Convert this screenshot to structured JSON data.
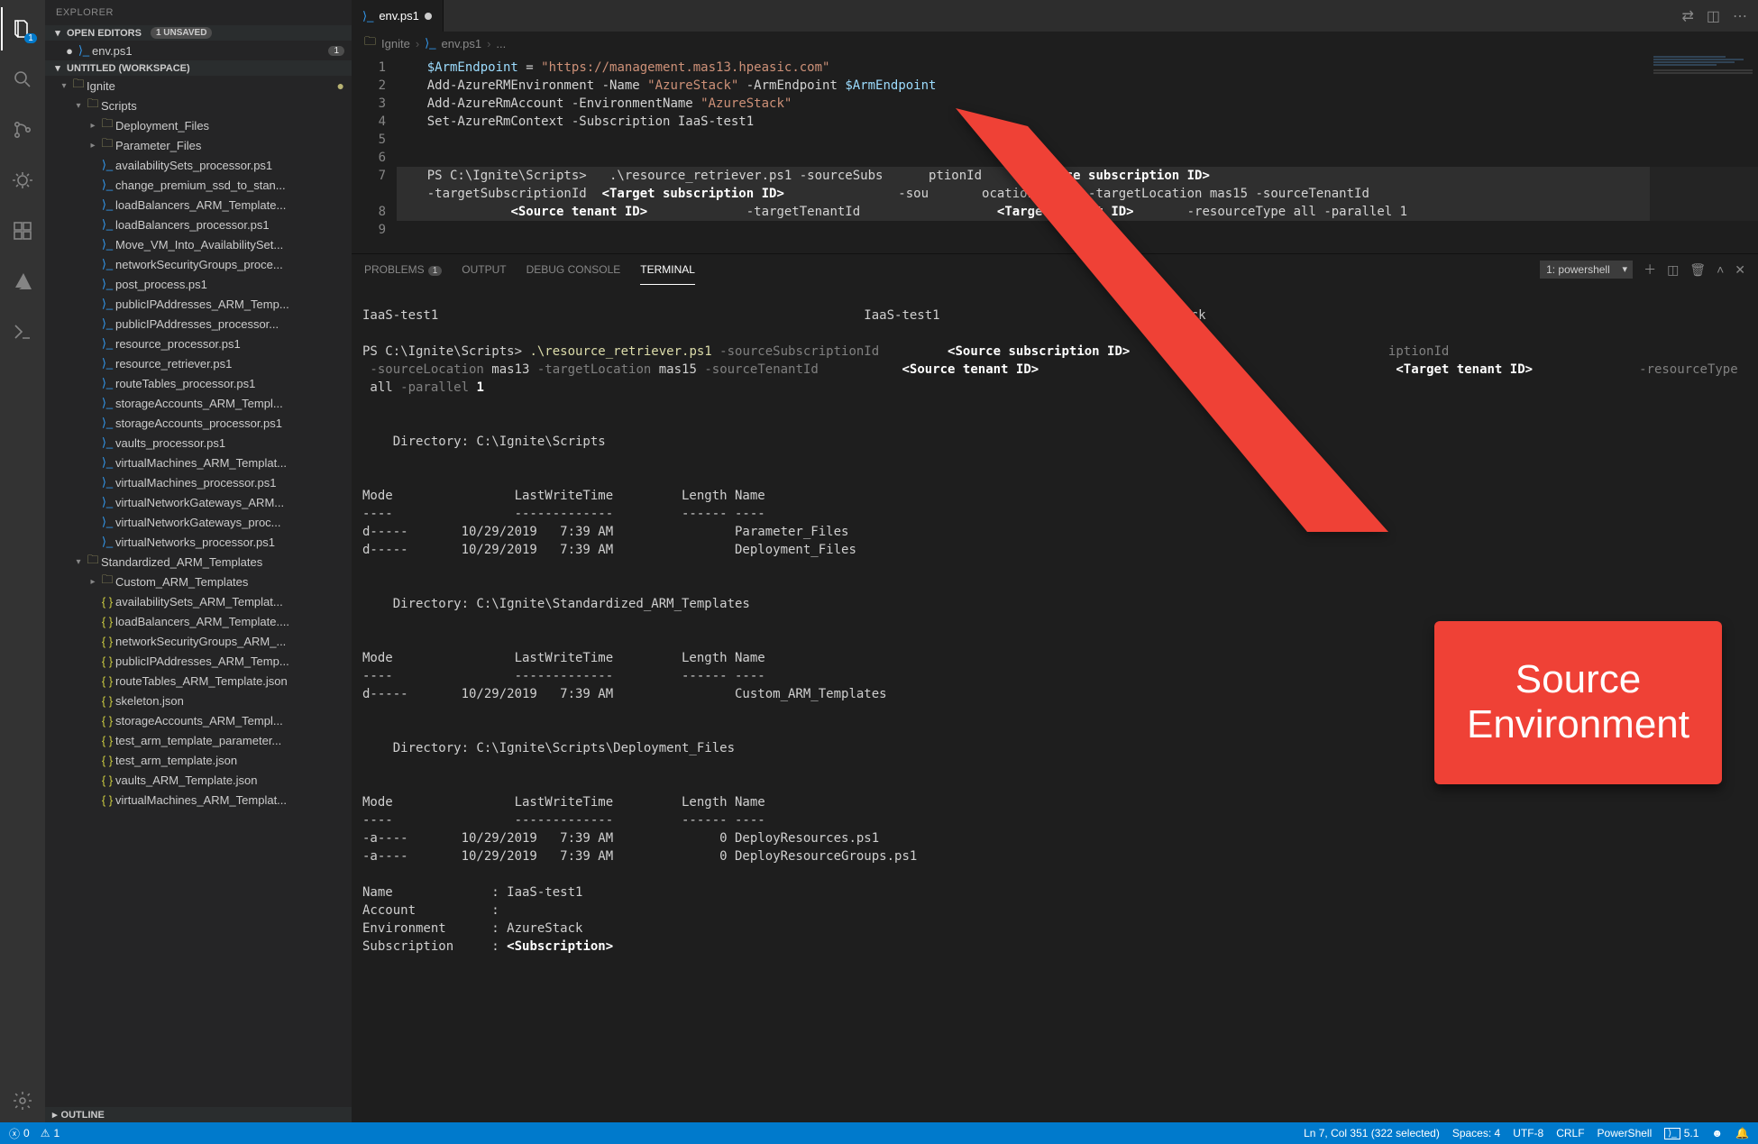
{
  "explorer": {
    "title": "EXPLORER",
    "open_editors_label": "OPEN EDITORS",
    "unsaved_pill": "1 UNSAVED",
    "open_editors": [
      {
        "label": "env.ps1",
        "badge": "1",
        "modified": true
      }
    ],
    "workspace_label": "UNTITLED (WORKSPACE)",
    "outline_label": "OUTLINE",
    "tree": [
      {
        "depth": 0,
        "twist": "v",
        "icon": "folder",
        "label": "Ignite",
        "modified": true
      },
      {
        "depth": 1,
        "twist": "v",
        "icon": "folder",
        "label": "Scripts"
      },
      {
        "depth": 2,
        "twist": ">",
        "icon": "folder",
        "label": "Deployment_Files"
      },
      {
        "depth": 2,
        "twist": ">",
        "icon": "folder",
        "label": "Parameter_Files"
      },
      {
        "depth": 2,
        "twist": "",
        "icon": "ps",
        "label": "availabilitySets_processor.ps1"
      },
      {
        "depth": 2,
        "twist": "",
        "icon": "ps",
        "label": "change_premium_ssd_to_stan..."
      },
      {
        "depth": 2,
        "twist": "",
        "icon": "ps",
        "label": "loadBalancers_ARM_Template..."
      },
      {
        "depth": 2,
        "twist": "",
        "icon": "ps",
        "label": "loadBalancers_processor.ps1"
      },
      {
        "depth": 2,
        "twist": "",
        "icon": "ps",
        "label": "Move_VM_Into_AvailabilitySet..."
      },
      {
        "depth": 2,
        "twist": "",
        "icon": "ps",
        "label": "networkSecurityGroups_proce..."
      },
      {
        "depth": 2,
        "twist": "",
        "icon": "ps",
        "label": "post_process.ps1"
      },
      {
        "depth": 2,
        "twist": "",
        "icon": "ps",
        "label": "publicIPAddresses_ARM_Temp..."
      },
      {
        "depth": 2,
        "twist": "",
        "icon": "ps",
        "label": "publicIPAddresses_processor..."
      },
      {
        "depth": 2,
        "twist": "",
        "icon": "ps",
        "label": "resource_processor.ps1"
      },
      {
        "depth": 2,
        "twist": "",
        "icon": "ps",
        "label": "resource_retriever.ps1"
      },
      {
        "depth": 2,
        "twist": "",
        "icon": "ps",
        "label": "routeTables_processor.ps1"
      },
      {
        "depth": 2,
        "twist": "",
        "icon": "ps",
        "label": "storageAccounts_ARM_Templ..."
      },
      {
        "depth": 2,
        "twist": "",
        "icon": "ps",
        "label": "storageAccounts_processor.ps1"
      },
      {
        "depth": 2,
        "twist": "",
        "icon": "ps",
        "label": "vaults_processor.ps1"
      },
      {
        "depth": 2,
        "twist": "",
        "icon": "ps",
        "label": "virtualMachines_ARM_Templat..."
      },
      {
        "depth": 2,
        "twist": "",
        "icon": "ps",
        "label": "virtualMachines_processor.ps1"
      },
      {
        "depth": 2,
        "twist": "",
        "icon": "ps",
        "label": "virtualNetworkGateways_ARM..."
      },
      {
        "depth": 2,
        "twist": "",
        "icon": "ps",
        "label": "virtualNetworkGateways_proc..."
      },
      {
        "depth": 2,
        "twist": "",
        "icon": "ps",
        "label": "virtualNetworks_processor.ps1"
      },
      {
        "depth": 1,
        "twist": "v",
        "icon": "folder",
        "label": "Standardized_ARM_Templates"
      },
      {
        "depth": 2,
        "twist": ">",
        "icon": "folder",
        "label": "Custom_ARM_Templates"
      },
      {
        "depth": 2,
        "twist": "",
        "icon": "json",
        "label": "availabilitySets_ARM_Templat..."
      },
      {
        "depth": 2,
        "twist": "",
        "icon": "json",
        "label": "loadBalancers_ARM_Template...."
      },
      {
        "depth": 2,
        "twist": "",
        "icon": "json",
        "label": "networkSecurityGroups_ARM_..."
      },
      {
        "depth": 2,
        "twist": "",
        "icon": "json",
        "label": "publicIPAddresses_ARM_Temp..."
      },
      {
        "depth": 2,
        "twist": "",
        "icon": "json",
        "label": "routeTables_ARM_Template.json"
      },
      {
        "depth": 2,
        "twist": "",
        "icon": "json",
        "label": "skeleton.json"
      },
      {
        "depth": 2,
        "twist": "",
        "icon": "json",
        "label": "storageAccounts_ARM_Templ..."
      },
      {
        "depth": 2,
        "twist": "",
        "icon": "json",
        "label": "test_arm_template_parameter..."
      },
      {
        "depth": 2,
        "twist": "",
        "icon": "json",
        "label": "test_arm_template.json"
      },
      {
        "depth": 2,
        "twist": "",
        "icon": "json",
        "label": "vaults_ARM_Template.json"
      },
      {
        "depth": 2,
        "twist": "",
        "icon": "json",
        "label": "virtualMachines_ARM_Templat..."
      }
    ]
  },
  "tabs": {
    "active": "env.ps1"
  },
  "breadcrumbs": {
    "a": "Ignite",
    "b": "env.ps1",
    "c": "..."
  },
  "editor_lines": [
    "1",
    "2",
    "3",
    "4",
    "5",
    "6",
    "7",
    "",
    "8",
    "9"
  ],
  "code": {
    "l1": {
      "a": "    ",
      "b": "$ArmEndpoint",
      "c": " = ",
      "d": "\"https://management.mas13.hpeasic.com\""
    },
    "l2": {
      "a": "    Add-AzureRMEnvironment ",
      "b": "-Name ",
      "c": "\"AzureStack\"",
      "d": " -ArmEndpoint ",
      "e": "$ArmEndpoint"
    },
    "l3": {
      "a": "    Add-AzureRmAccount ",
      "b": "-EnvironmentName ",
      "c": "\"AzureStack\""
    },
    "l4": {
      "a": "    Set-AzureRmContext ",
      "b": "-Subscription IaaS-test1"
    },
    "l7a": {
      "a": "    PS C:\\Ignite\\Scripts>   .\\resource_retriever.ps1 -sourceSubs      ptionId ",
      "b": "     <Source subscription ID>          "
    },
    "l7b": {
      "a": "    -targetSubscriptionId  ",
      "b": "<Target subscription ID>",
      "c": "               -sou       ocation mas13 -targetLocation mas15 -sourceTenantId"
    },
    "l7c": {
      "a": "               ",
      "b": "<Source tenant ID>",
      "c": "             -targetTenantId                  ",
      "d": "<Target tenant ID>",
      "e": "       -resourceType all -parallel 1"
    }
  },
  "panel": {
    "problems": "PROBLEMS",
    "problems_badge": "1",
    "output": "OUTPUT",
    "debug": "DEBUG CONSOLE",
    "terminal": "TERMINAL",
    "dropdown": "1: powershell"
  },
  "terminal": {
    "l01": "IaaS-test1                                                        IaaS-test1                              Stack",
    "l02": "",
    "l03a": "PS C:\\Ignite\\Scripts> ",
    "l03b": ".\\resource_retriever.ps1",
    "l03c": " -sourceSubscriptionId         ",
    "l03d": "<Source subscription ID>",
    "l03e": "                                  iptionId",
    "l04a": " -sourceLocation ",
    "l04b": "mas13",
    "l04c": " -targetLocation ",
    "l04d": "mas15",
    "l04e": " -sourceTenantId           ",
    "l04f": "<Source tenant ID>",
    "l04g": "                                               ",
    "l04h": "<Target tenant ID>",
    "l04i": "              -resourceType",
    "l05a": " all",
    "l05b": " -parallel ",
    "l05c": "1",
    "dir1": "    Directory: C:\\Ignite\\Scripts",
    "hdr": "Mode                LastWriteTime         Length Name",
    "hdr2": "----                -------------         ------ ----",
    "r1": "d-----       10/29/2019   7:39 AM                Parameter_Files",
    "r2": "d-----       10/29/2019   7:39 AM                Deployment_Files",
    "dir2": "    Directory: C:\\Ignite\\Standardized_ARM_Templates",
    "r3": "d-----       10/29/2019   7:39 AM                Custom_ARM_Templates",
    "dir3": "    Directory: C:\\Ignite\\Scripts\\Deployment_Files",
    "r4": "-a----       10/29/2019   7:39 AM              0 DeployResources.ps1",
    "r5": "-a----       10/29/2019   7:39 AM              0 DeployResourceGroups.ps1",
    "kv1": "Name             : IaaS-test1",
    "kv2": "Account          :",
    "kv3": "Environment      : AzureStack",
    "kv4a": "Subscription     : ",
    "kv4b": "<Subscription>"
  },
  "status": {
    "errors": "0",
    "warnings": "1",
    "lncol": "Ln 7, Col 351 (322 selected)",
    "spaces": "Spaces: 4",
    "encoding": "UTF-8",
    "eol": "CRLF",
    "lang": "PowerShell",
    "ps": "5.1",
    "bell": "🔔"
  },
  "callout": {
    "line1": "Source",
    "line2": "Environment"
  },
  "colors": {
    "red": "#ef4136",
    "accent": "#007acc"
  }
}
